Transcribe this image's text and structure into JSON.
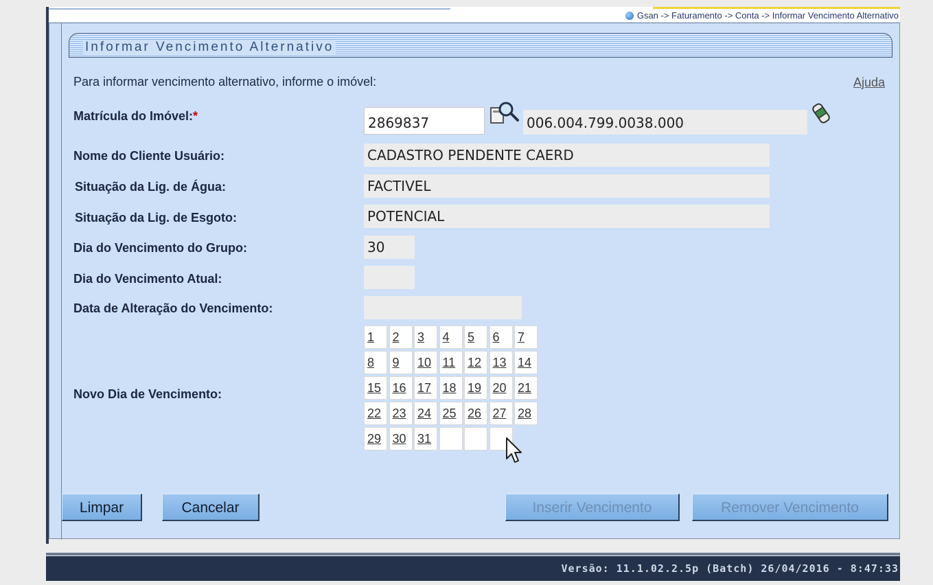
{
  "breadcrumb": "Gsan -> Faturamento -> Conta -> Informar Vencimento Alternativo",
  "panel": {
    "title": "Informar Vencimento Alternativo",
    "intro": "Para informar vencimento alternativo, informe o imóvel:",
    "help_link": "Ajuda"
  },
  "form": {
    "matricula_label": "Matrícula do Imóvel:",
    "required_mark": "*",
    "matricula_value": "2869837",
    "inscricao_value": "006.004.799.0038.000",
    "nome_label": "Nome do Cliente Usuário:",
    "nome_value": "CADASTRO PENDENTE CAERD",
    "agua_label": "Situação da Lig. de Água:",
    "agua_value": "FACTIVEL",
    "esgoto_label": "Situação da Lig. de Esgoto:",
    "esgoto_value": "POTENCIAL",
    "dia_grupo_label": "Dia do Vencimento do Grupo:",
    "dia_grupo_value": "30",
    "dia_atual_label": "Dia do Vencimento Atual:",
    "dia_atual_value": "",
    "data_alteracao_label": "Data de Alteração do Vencimento:",
    "data_alteracao_value": "",
    "novo_dia_label": "Novo Dia de Vencimento:"
  },
  "days": [
    "1",
    "2",
    "3",
    "4",
    "5",
    "6",
    "7",
    "8",
    "9",
    "10",
    "11",
    "12",
    "13",
    "14",
    "15",
    "16",
    "17",
    "18",
    "19",
    "20",
    "21",
    "22",
    "23",
    "24",
    "25",
    "26",
    "27",
    "28",
    "29",
    "30",
    "31",
    "",
    "",
    ""
  ],
  "buttons": {
    "limpar": "Limpar",
    "cancelar": "Cancelar",
    "inserir": "Inserir Vencimento",
    "remover": "Remover Vencimento"
  },
  "footer": "Versão: 11.1.02.2.5p (Batch) 26/04/2016 - 8:47:33",
  "icons": {
    "search": "search-icon",
    "eraser": "eraser-icon",
    "globe": "globe-icon",
    "cursor": "mouse-cursor-icon"
  },
  "colors": {
    "panel_bg": "#cde0f7",
    "button_bg": "#86b6e7",
    "footer_bg": "#24324b",
    "required": "#d00000"
  }
}
